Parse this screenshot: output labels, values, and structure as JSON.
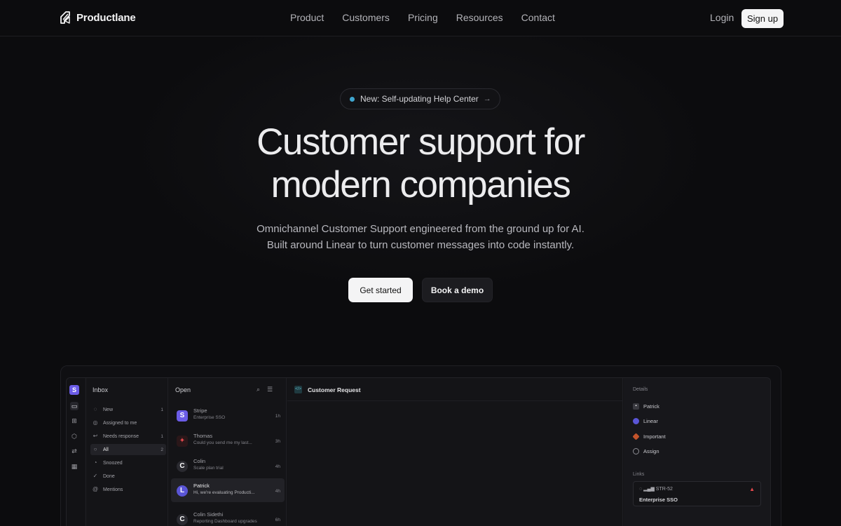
{
  "brand": {
    "name": "Productlane"
  },
  "nav": {
    "links": [
      "Product",
      "Customers",
      "Pricing",
      "Resources",
      "Contact"
    ],
    "login": "Login",
    "signup": "Sign up"
  },
  "hero": {
    "pill": "New: Self-updating Help Center",
    "pill_arrow": "→",
    "title_line1": "Customer support for",
    "title_line2": "modern companies",
    "sub_line1": "Omnichannel Customer Support engineered from the ground up for AI.",
    "sub_line2": "Built around Linear to turn customer messages into code instantly.",
    "cta_primary": "Get started",
    "cta_secondary": "Book a demo"
  },
  "app": {
    "workspace_initial": "S",
    "inbox": {
      "title": "Inbox",
      "items": [
        {
          "label": "New",
          "count": "1",
          "icon": "dashed-circle-icon"
        },
        {
          "label": "Assigned to me",
          "count": "",
          "icon": "user-circle-icon"
        },
        {
          "label": "Needs response",
          "count": "1",
          "icon": "reply-icon"
        },
        {
          "label": "All",
          "count": "2",
          "icon": "circle-icon",
          "active": true
        },
        {
          "label": "Snoozed",
          "count": "",
          "icon": "moon-icon"
        },
        {
          "label": "Done",
          "count": "",
          "icon": "check-circle-icon"
        },
        {
          "label": "Mentions",
          "count": "",
          "icon": "at-icon"
        }
      ]
    },
    "open": {
      "title": "Open",
      "conversations": [
        {
          "name": "Stripe",
          "preview": "Enterprise SSO",
          "time": "1h",
          "avatar": "S",
          "color": "#6b5ce7"
        },
        {
          "name": "Thomas",
          "preview": "Could you send me my last...",
          "time": "3h",
          "avatar": "✦",
          "color": "#3a1f22"
        },
        {
          "name": "Colin",
          "preview": "Scale plan trial",
          "time": "4h",
          "avatar": "C",
          "color": "#2a2a30"
        },
        {
          "name": "Patrick",
          "preview": "Hi, we're evaluating Producti...",
          "time": "4h",
          "avatar": "L",
          "color": "#5a55d6",
          "active": true
        },
        {
          "name": "Colin Sidethi",
          "preview": "Reporting Dashboard upgrades",
          "time": "6h",
          "avatar": "C",
          "color": "#2a2a30"
        }
      ]
    },
    "main": {
      "title": "Customer Request"
    },
    "details": {
      "label": "Details",
      "rows": [
        {
          "text": "Patrick",
          "icon": "person-icon",
          "color": "#3a3a40"
        },
        {
          "text": "Linear",
          "icon": "linear-icon",
          "color": "#5a55d6"
        },
        {
          "text": "Important",
          "icon": "priority-icon",
          "color": "#c2532b"
        },
        {
          "text": "Assign",
          "icon": "assign-icon",
          "color": "#2a2a30"
        }
      ],
      "links_label": "Links",
      "link": {
        "id": "STR-52",
        "title": "Enterprise SSO"
      }
    }
  }
}
